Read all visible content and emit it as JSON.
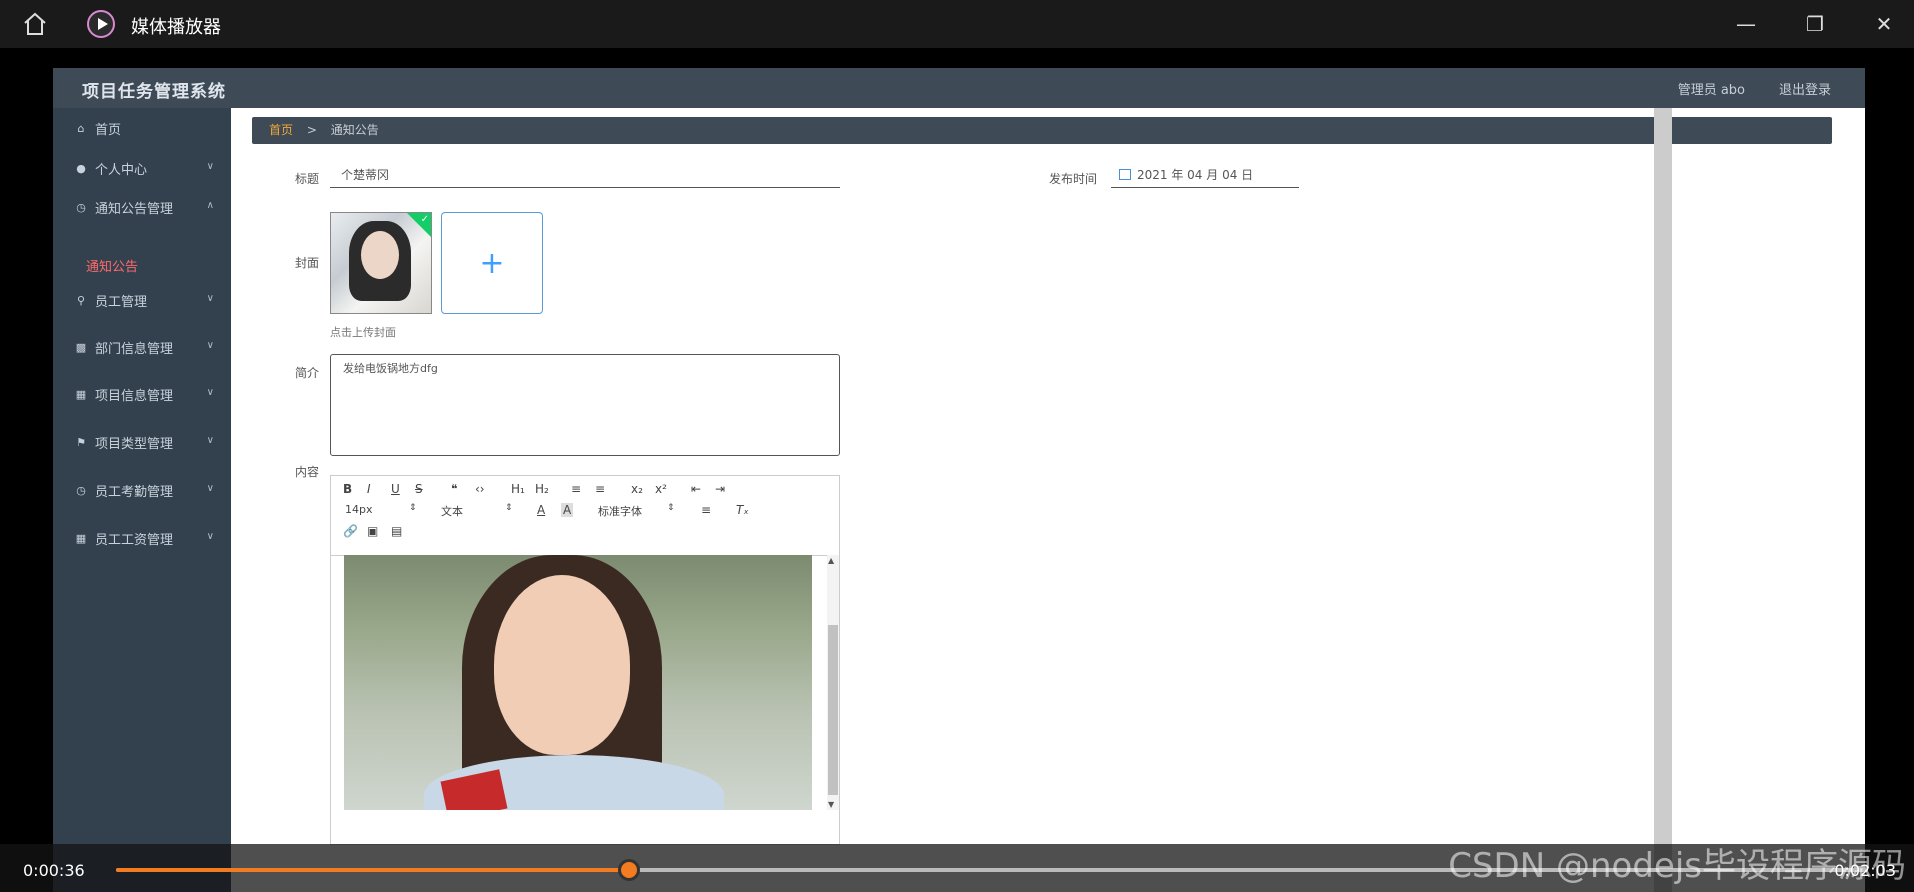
{
  "player": {
    "title": "媒体播放器",
    "current_time": "0:00:36",
    "total_time": "0:02:03",
    "progress": 0.2927,
    "accent_color": "#f47c20"
  },
  "app": {
    "title": "项目任务管理系统",
    "admin": "管理员 abo",
    "logout": "退出登录"
  },
  "sidebar": {
    "items": [
      {
        "label": "首页",
        "icon": "home-icon"
      },
      {
        "label": "个人中心",
        "icon": "user-icon"
      },
      {
        "label": "通知公告管理",
        "icon": "clock-icon"
      },
      {
        "label": "员工管理",
        "icon": "mic-icon"
      },
      {
        "label": "部门信息管理",
        "icon": "monitor-icon"
      },
      {
        "label": "项目信息管理",
        "icon": "grid-icon"
      },
      {
        "label": "项目类型管理",
        "icon": "flag-icon"
      },
      {
        "label": "员工考勤管理",
        "icon": "clock-icon"
      },
      {
        "label": "员工工资管理",
        "icon": "table-icon"
      }
    ],
    "sub_item": "通知公告"
  },
  "breadcrumb": {
    "home": "首页",
    "sep": ">",
    "current": "通知公告"
  },
  "form": {
    "title_label": "标题",
    "title_value": "个楚蒂冈",
    "publish_label": "发布时间",
    "publish_value": "2021 年 04 月 04 日",
    "cover_label": "封面",
    "cover_hint": "点击上传封面",
    "intro_label": "简介",
    "intro_value": "发给电饭锅地方dfg",
    "content_label": "内容"
  },
  "editor": {
    "font_size": "14px",
    "text_type": "文本",
    "font_family": "标准字体"
  },
  "watermark": "CSDN @nodejs毕设程序源码"
}
